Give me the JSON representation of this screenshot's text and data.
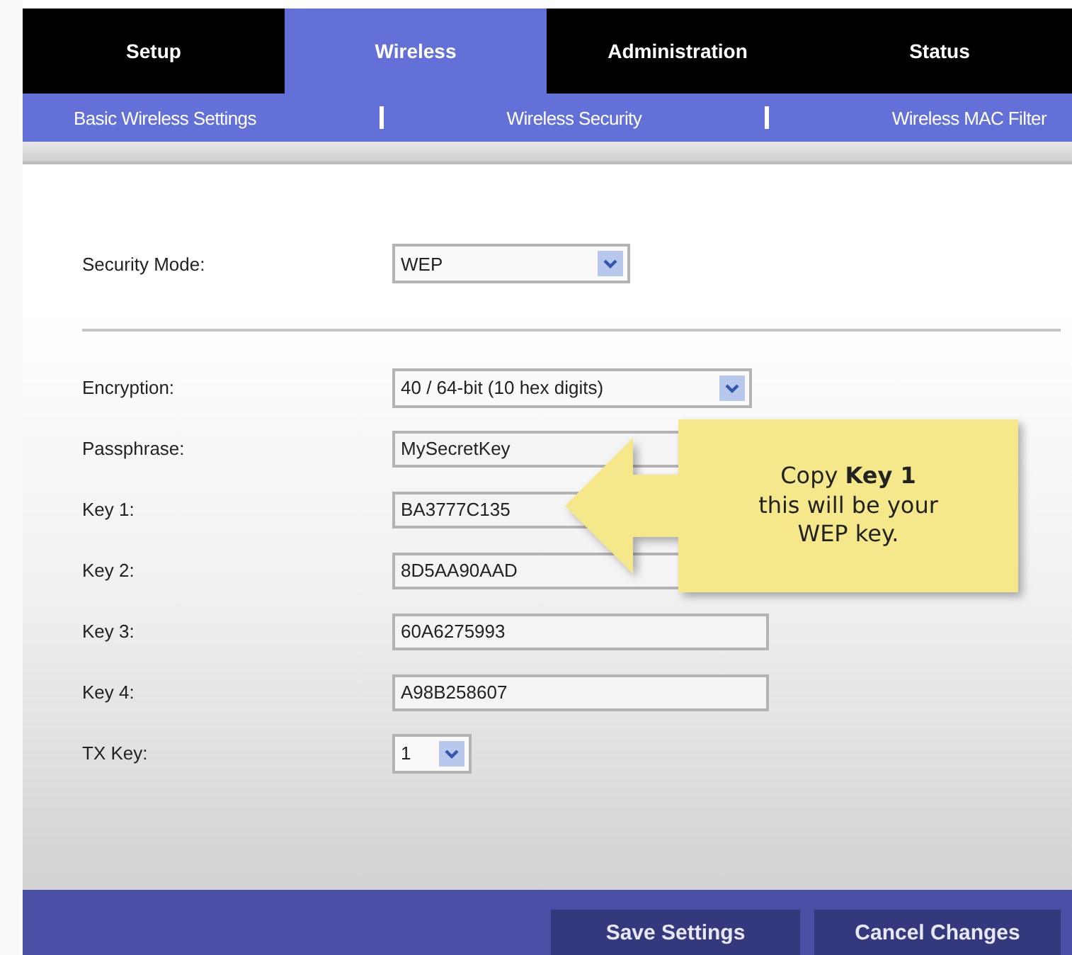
{
  "tabs": [
    {
      "label": "Setup",
      "selected": false
    },
    {
      "label": "Wireless",
      "selected": true
    },
    {
      "label": "Administration",
      "selected": false
    },
    {
      "label": "Status",
      "selected": false
    }
  ],
  "subtabs": [
    "Basic Wireless Settings",
    "Wireless Security",
    "Wireless MAC Filter"
  ],
  "security_mode": {
    "label": "Security Mode:",
    "value": "WEP"
  },
  "fields": [
    {
      "kind": "dropdown",
      "label": "Encryption:",
      "value": "40 / 64-bit (10 hex digits)"
    },
    {
      "kind": "text",
      "label": "Passphrase:",
      "value": "MySecretKey"
    },
    {
      "kind": "text",
      "label": "Key 1:",
      "value": "BA3777C135"
    },
    {
      "kind": "text",
      "label": "Key 2:",
      "value": "8D5AA90AAD"
    },
    {
      "kind": "text",
      "label": "Key 3:",
      "value": "60A6275993"
    },
    {
      "kind": "text",
      "label": "Key 4:",
      "value": "A98B258607"
    },
    {
      "kind": "small-dropdown",
      "label": "TX Key:",
      "value": "1"
    }
  ],
  "callout": "Copy **Key 1**\nthis will be your\nWEP key.",
  "buttons": [
    "Save Settings",
    "Cancel Changes"
  ]
}
